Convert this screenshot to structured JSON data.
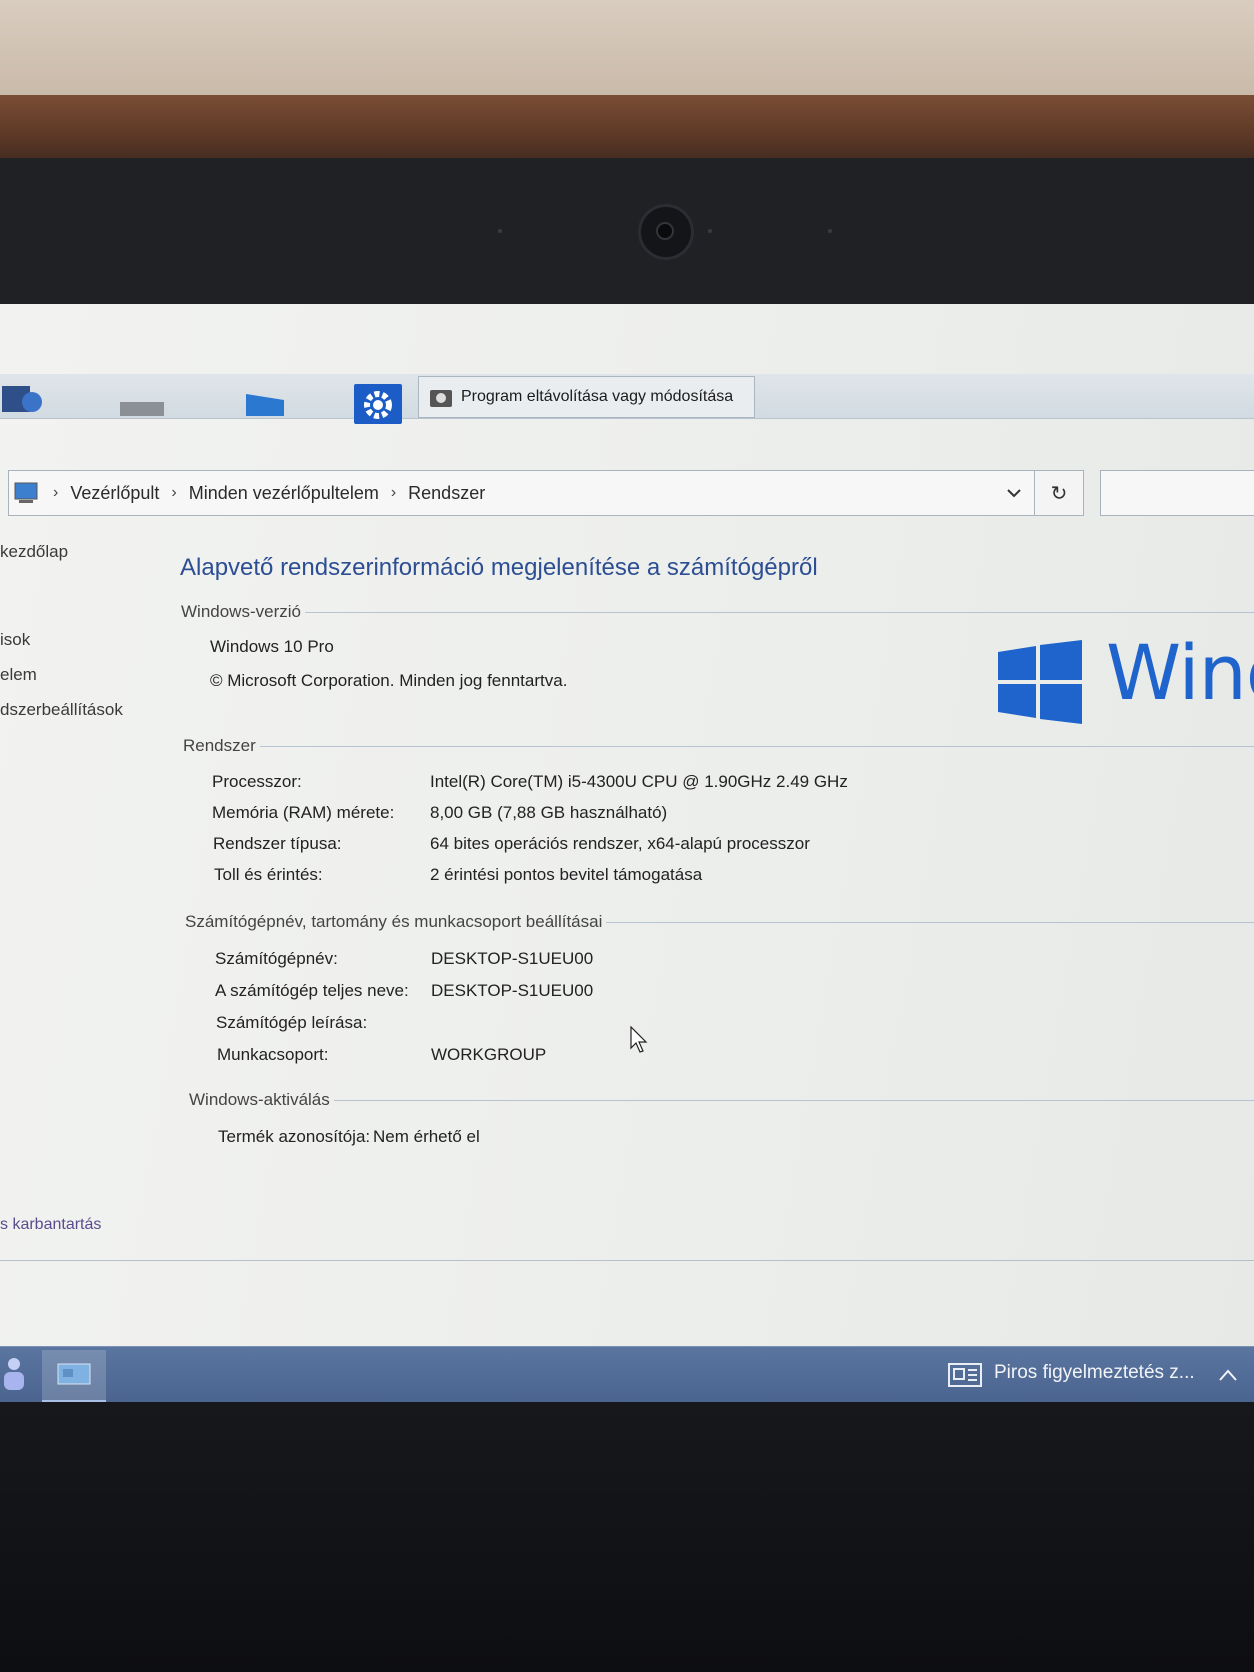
{
  "toolbar": {
    "popup_label": "Program eltávolítása vagy módosítása"
  },
  "address": {
    "crumbs": [
      "Vezérlőpult",
      "Minden vezérlőpultelem",
      "Rendszer"
    ]
  },
  "left_nav": {
    "items": [
      "kezdőlap",
      "isok",
      "elem",
      "dszerbeállítások"
    ],
    "bottom_link": "s karbantartás"
  },
  "main": {
    "title": "Alapvető rendszerinformáció megjelenítése a számítógépről",
    "windows_version": {
      "header": "Windows-verzió",
      "edition": "Windows 10 Pro",
      "copyright": "© Microsoft Corporation. Minden jog fenntartva.",
      "logo_text": "Wind"
    },
    "system": {
      "header": "Rendszer",
      "rows": [
        {
          "label": "Processzor:",
          "value": "Intel(R) Core(TM) i5-4300U CPU @ 1.90GHz   2.49 GHz"
        },
        {
          "label": "Memória (RAM) mérete:",
          "value": "8,00 GB (7,88 GB használható)"
        },
        {
          "label": "Rendszer típusa:",
          "value": "64 bites operációs rendszer, x64-alapú processzor"
        },
        {
          "label": "Toll és érintés:",
          "value": "2 érintési pontos bevitel támogatása"
        }
      ]
    },
    "computer": {
      "header": "Számítógépnév, tartomány és munkacsoport beállításai",
      "rows": [
        {
          "label": "Számítógépnév:",
          "value": "DESKTOP-S1UEU00"
        },
        {
          "label": "A számítógép teljes neve:",
          "value": "DESKTOP-S1UEU00"
        },
        {
          "label": "Számítógép leírása:",
          "value": ""
        },
        {
          "label": "Munkacsoport:",
          "value": "WORKGROUP"
        }
      ]
    },
    "activation": {
      "header": "Windows-aktiválás",
      "product_id_label": "Termék azonosítója:",
      "product_id_value": "Nem érhető el"
    }
  },
  "taskbar": {
    "news_text": "Piros figyelmeztetés z..."
  },
  "colors": {
    "accent": "#1f64cc",
    "title": "#2d4e93",
    "taskbar": "#4a648f"
  }
}
